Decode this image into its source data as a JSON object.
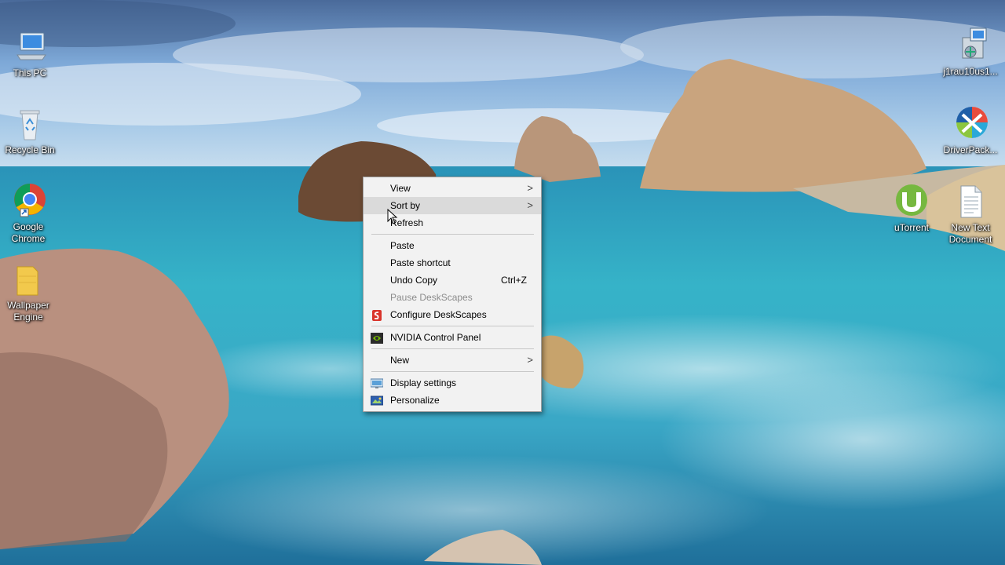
{
  "desktop": {
    "icons_left": [
      {
        "label": "This PC",
        "icon": "this-pc-icon"
      },
      {
        "label": "Recycle Bin",
        "icon": "recycle-bin-icon"
      },
      {
        "label": "Google\nChrome",
        "icon": "google-chrome-icon"
      },
      {
        "label": "Wallpaper\nEngine",
        "icon": "wallpaper-engine-icon"
      }
    ],
    "icons_right": [
      {
        "label": "j1rau10us1...",
        "icon": "installer-icon"
      },
      {
        "label": "DriverPack...",
        "icon": "driverpack-icon"
      },
      {
        "label": "uTorrent",
        "icon": "utorrent-icon"
      },
      {
        "label": "New Text\nDocument",
        "icon": "text-document-icon"
      }
    ]
  },
  "context_menu": {
    "items": [
      {
        "label": "View",
        "submenu": true
      },
      {
        "label": "Sort by",
        "submenu": true,
        "hover": true
      },
      {
        "label": "Refresh"
      },
      {
        "separator": true
      },
      {
        "label": "Paste"
      },
      {
        "label": "Paste shortcut"
      },
      {
        "label": "Undo Copy",
        "shortcut": "Ctrl+Z"
      },
      {
        "label": "Pause DeskScapes",
        "disabled": true
      },
      {
        "label": "Configure DeskScapes",
        "icon": "deskscapes-icon"
      },
      {
        "separator": true
      },
      {
        "label": "NVIDIA Control Panel",
        "icon": "nvidia-icon"
      },
      {
        "separator": true
      },
      {
        "label": "New",
        "submenu": true
      },
      {
        "separator": true
      },
      {
        "label": "Display settings",
        "icon": "display-settings-icon"
      },
      {
        "label": "Personalize",
        "icon": "personalize-icon"
      }
    ]
  },
  "colors": {
    "menu_bg": "#f2f2f2",
    "menu_hover": "#dadada",
    "menu_disabled": "#8c8c8c",
    "sea": "#2fa9c4",
    "sky": "#6fa6d6"
  }
}
